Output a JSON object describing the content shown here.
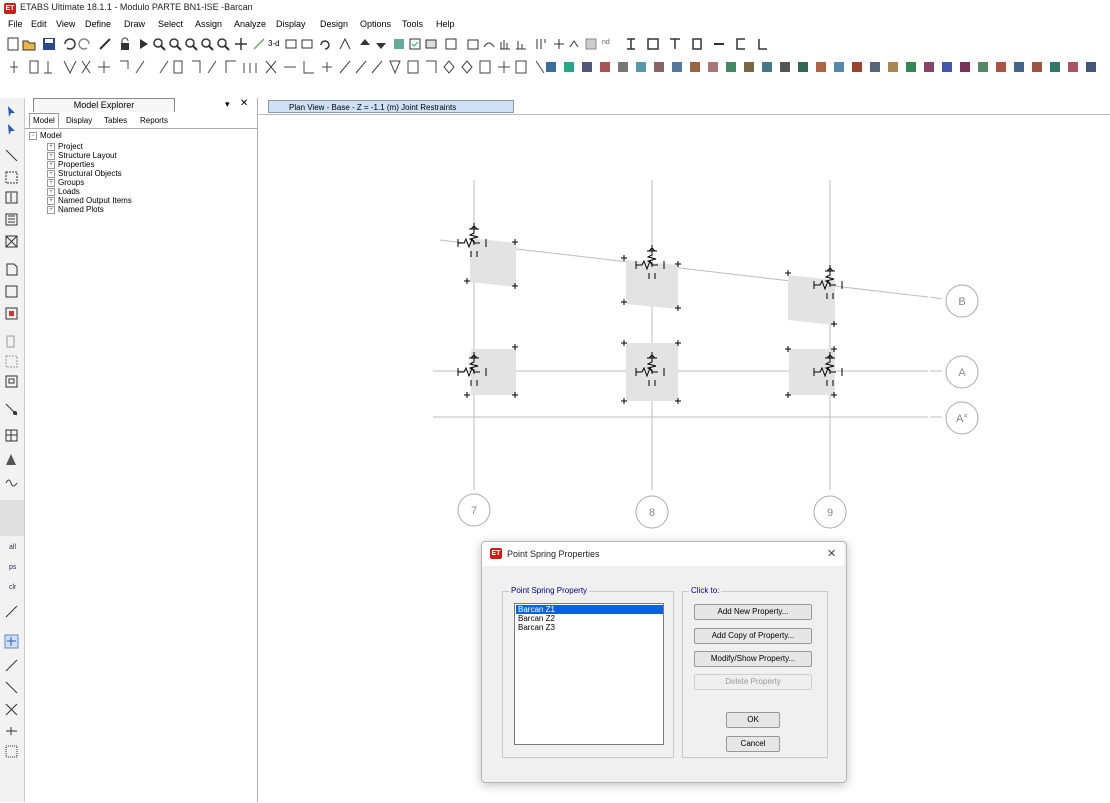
{
  "window": {
    "app_icon": "ET",
    "title": "ETABS Ultimate 18.1.1 - Modulo PARTE BN1-ISE -Barcan"
  },
  "menu": [
    "File",
    "Edit",
    "View",
    "Define",
    "Draw",
    "Select",
    "Assign",
    "Analyze",
    "Display",
    "Design",
    "Options",
    "Tools",
    "Help"
  ],
  "toolbar": {
    "view_3d_label": "3-d",
    "nd_label": "nd"
  },
  "explorer": {
    "title": "Model Explorer",
    "pin": "▾",
    "close": "✕",
    "tabs": [
      "Model",
      "Display",
      "Tables",
      "Reports"
    ],
    "root": "Model",
    "children": [
      "Project",
      "Structure Layout",
      "Properties",
      "Structural Objects",
      "Groups",
      "Loads",
      "Named Output Items",
      "Named Plots"
    ]
  },
  "view_tab": "Plan View - Base - Z = -1.1 (m)  Joint Restraints",
  "grid_labels": {
    "rows": [
      "B",
      "A",
      "A°"
    ],
    "cols": [
      "7",
      "8",
      "9"
    ]
  },
  "dialog": {
    "icon": "ET",
    "title": "Point Spring Properties",
    "close": "✕",
    "group_left": "Point Spring Property",
    "group_right": "Click to:",
    "items": [
      "Barcan Z1",
      "Barcan Z2",
      "Barcan Z3"
    ],
    "selected_index": 0,
    "buttons": {
      "add_new": "Add New Property...",
      "add_copy": "Add Copy of Property...",
      "modify": "Modify/Show Property...",
      "delete": "Delete Property",
      "ok": "OK",
      "cancel": "Cancel"
    }
  },
  "left_tool_labels": [
    "all",
    "ps",
    "clr"
  ],
  "colors": {
    "accent": "#0a64d8",
    "etabs_red": "#c4211b",
    "tab_blue": "#cfe0f5"
  }
}
